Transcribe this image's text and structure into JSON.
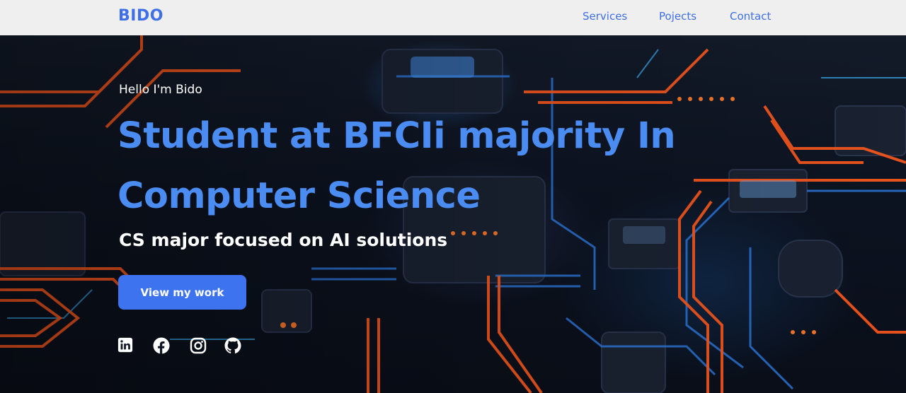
{
  "header": {
    "logo": "BIDO",
    "nav": [
      {
        "label": "Services"
      },
      {
        "label": "Pojects"
      },
      {
        "label": "Contact"
      }
    ]
  },
  "hero": {
    "greeting": "Hello I'm Bido",
    "headline": "Student at BFCIi majority In Computer Science",
    "tagline": "CS major focused on AI solutions",
    "cta_label": "View my work",
    "socials": [
      {
        "icon": "linkedin-icon"
      },
      {
        "icon": "facebook-icon"
      },
      {
        "icon": "instagram-icon"
      },
      {
        "icon": "github-icon"
      }
    ]
  },
  "colors": {
    "accent": "#3f6fe8",
    "headline": "#4a8cf2",
    "button": "#3d73ef",
    "header_bg": "#efefef"
  }
}
